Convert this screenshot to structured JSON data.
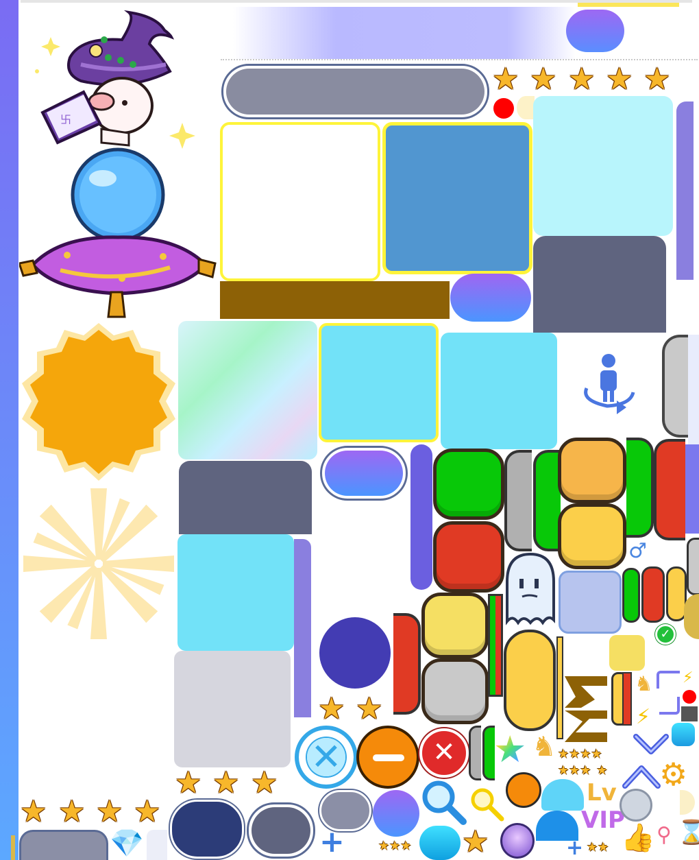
{
  "sprite_sheet": {
    "lv_label": "Lv",
    "vip_label": "VIP",
    "gender_symbol": "♂",
    "plus_symbol": "+",
    "colors": {
      "side_bar_top": "#5db0ff",
      "side_bar_bottom": "#7f6cf0",
      "slate": "#5f647f",
      "cyan": "#72e2f8",
      "pale_cyan": "#b8f5fc",
      "steel_blue": "#5196d0",
      "brown": "#8d6106",
      "orange": "#f5a60b",
      "green": "#08c808",
      "red": "#e03a24",
      "gray": "#c9c9c9",
      "yellow": "#f5df63",
      "indigo": "#433cb3",
      "navy": "#2c3c78",
      "gray_blue": "#8b8fa6",
      "lavender": "#b7c4ee",
      "purple_bar": "#8a7fdf"
    },
    "icons": [
      "wizard-pig-on-crystal-ball",
      "star-icon",
      "close-circle-icon",
      "minus-circle-icon",
      "red-close-icon",
      "magnifier-icon",
      "rainbow-star-icon",
      "ghost-icon",
      "checkmark-icon",
      "lightning-icon",
      "chevron-down-icon",
      "chevron-up-icon",
      "gear-icon",
      "thumbs-up-icon",
      "hourglass-icon",
      "diamond-icon",
      "rotate-person-icon",
      "key-icon",
      "cat-coin-icon"
    ]
  }
}
